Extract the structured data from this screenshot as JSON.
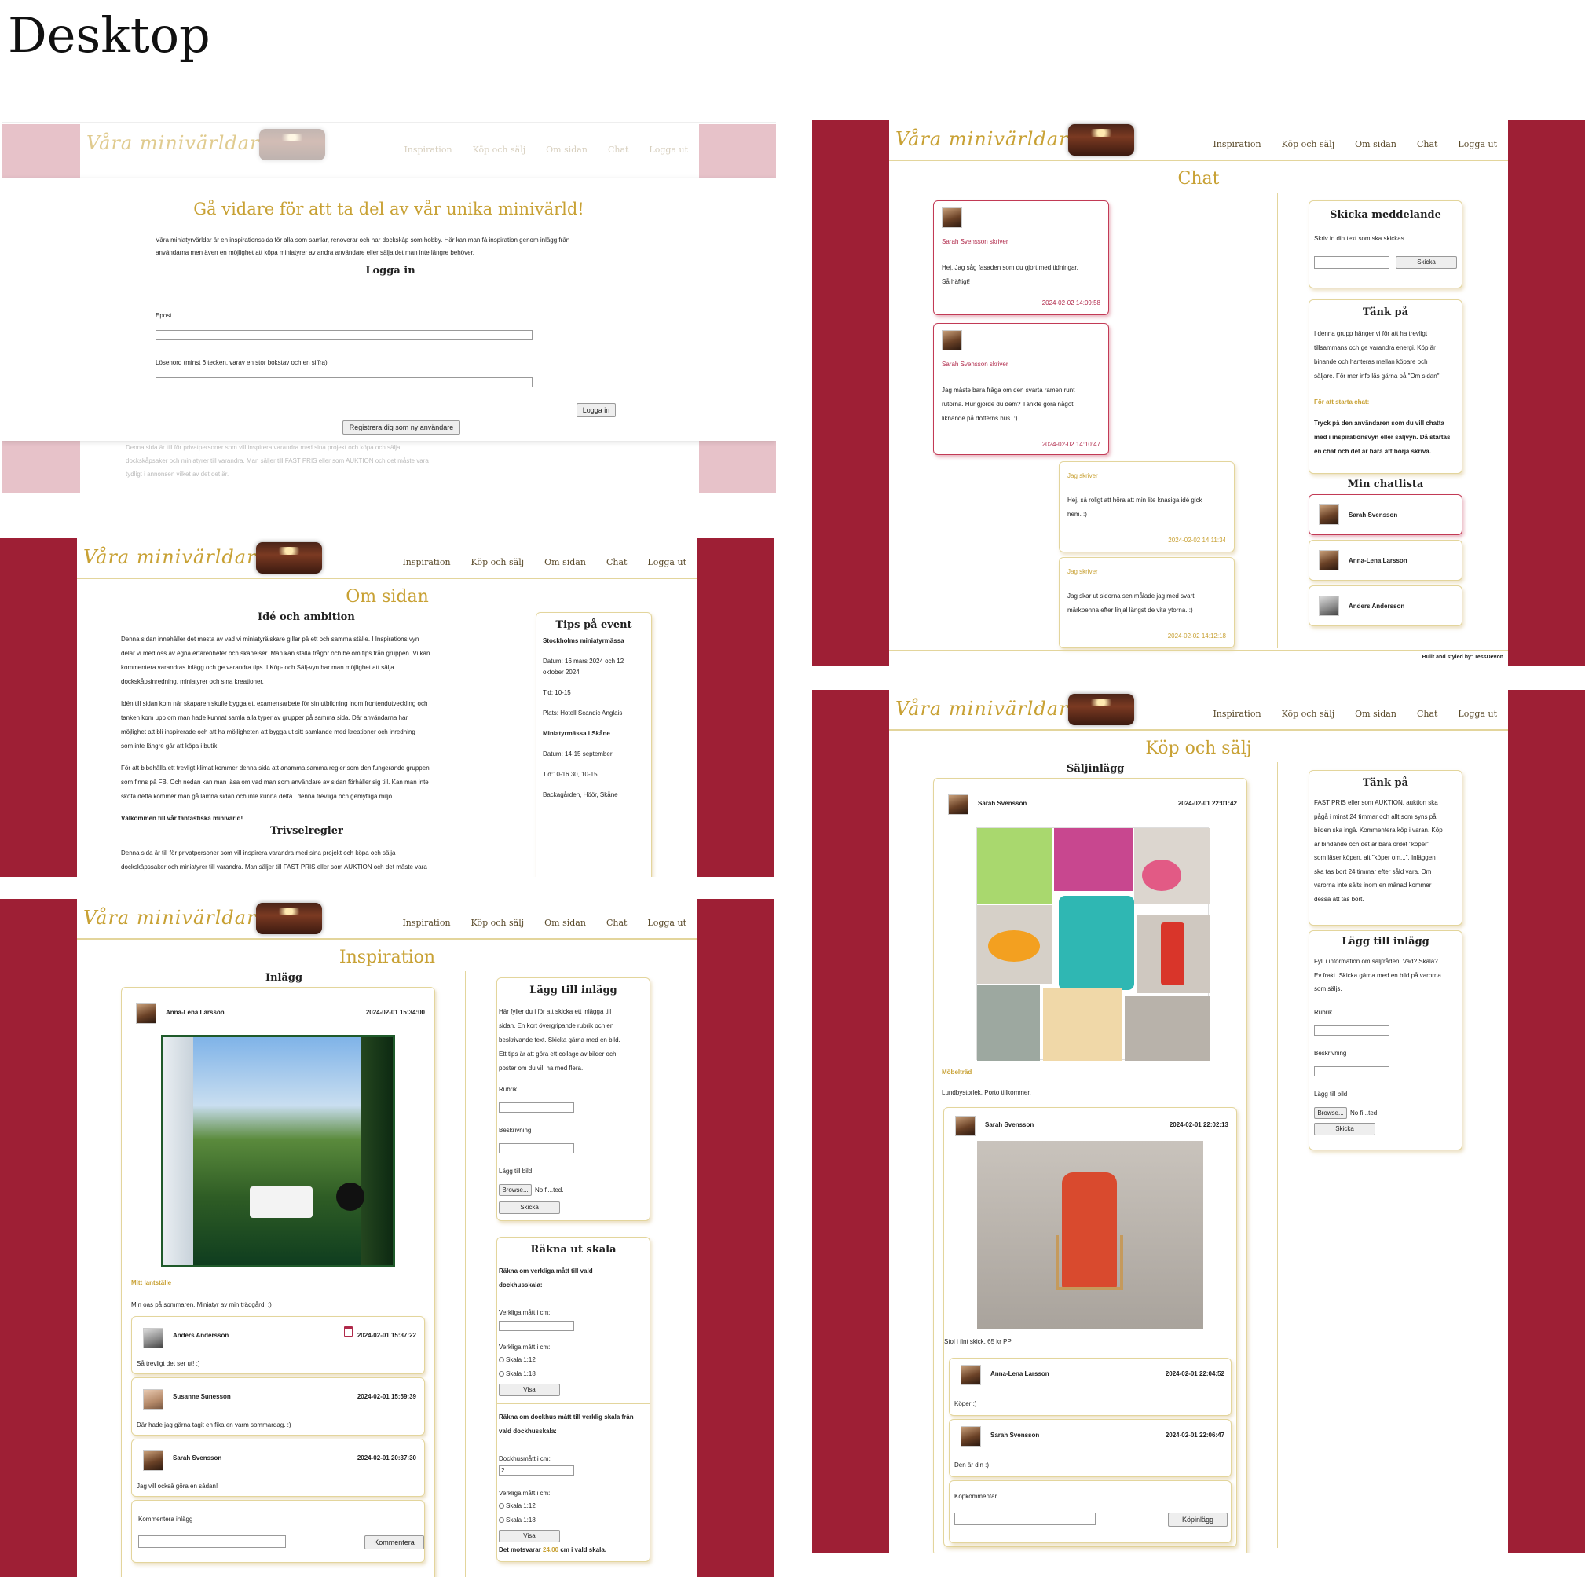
{
  "page_title": "Desktop",
  "site": {
    "logo_text": "Våra minivärldar",
    "nav": [
      "Inspiration",
      "Köp och sälj",
      "Om sidan",
      "Chat",
      "Logga ut"
    ],
    "colors": {
      "side": "#9e1f35",
      "gold": "#c8a134",
      "pink_side": "#e7c2c9"
    }
  },
  "login": {
    "title": "Gå vidare för att ta del av vår unika minivärld!",
    "intro_1": "Våra miniatyrvärldar är en inspirationssida för alla som samlar, renoverar och har dockskåp som hobby. Här kan man få inspiration genom inlägg från",
    "intro_2": "användarna men även en möjlighet att köpa miniatyrer av andra användare eller sälja det man inte längre behöver.",
    "heading": "Logga in",
    "email_label": "Epost",
    "password_label": "Lösenord (minst 6 tecken, varav en stor bokstav och en siffra)",
    "login_button": "Logga in",
    "register_button": "Registrera dig som ny användare",
    "bg_text_1": "Denna sida är till för privatpersoner som vill inspirera varandra med sina projekt och köpa och sälja",
    "bg_text_2": "dockskåpsaker och miniatyrer till varandra. Man säljer till FAST PRIS eller som AUKTION och det måste vara",
    "bg_text_3": "tydligt i annonsen vilket av det det är."
  },
  "about": {
    "title": "Om sidan",
    "idea_heading": "Idé och ambition",
    "p1": [
      "Denna sidan innehåller det mesta av vad vi miniatyrälskare gillar på ett och samma ställe. I Inspirations vyn",
      "delar vi med oss av egna erfarenheter och skapelser. Man kan ställa frågor och be om tips från gruppen. Vi kan",
      "kommentera varandras inlägg och ge varandra tips. I Köp- och Sälj-vyn har man möjlighet att sälja",
      "dockskåpsinredning, miniatyrer och sina kreationer."
    ],
    "p2": [
      "Idén till sidan kom när skaparen skulle bygga ett examensarbete för sin utbildning inom frontendutveckling och",
      "tanken kom upp om man hade kunnat samla alla typer av grupper på samma sida. Där användarna har",
      "möjlighet att bli inspirerade och att ha möjligheten att bygga ut sitt samlande med kreationer och inredning",
      "som inte längre går att köpa i butik."
    ],
    "p3": [
      "För att bibehålla ett trevligt klimat kommer denna sida att anamma samma regler som den fungerande gruppen",
      "som finns på FB. Och nedan kan man läsa om vad man som användare av sidan förhåller sig till. Kan man inte",
      "sköta detta kommer man gå lämna sidan och inte kunna delta i denna trevliga och gemytliga miljö."
    ],
    "welcome": "Välkommen till vår fantastiska minivärld!",
    "rules_heading": "Trivselregler",
    "rules_1": "Denna sida är till för privatpersoner som vill inspirera varandra med sina projekt och köpa och sälja",
    "rules_2": "dockskåpssaker och miniatyrer till varandra. Man säljer till FAST PRIS eller som AUKTION och det måste vara",
    "tips_heading": "Tips på event",
    "tips": [
      "Stockholms miniatyrmässa",
      "Datum: 16 mars 2024 och 12",
      "oktober 2024",
      "Tid: 10-15",
      "Plats: Hotell Scandic Anglais",
      "Miniatyrmässa i Skåne",
      "Datum: 14-15 september",
      "Tid:10-16.30, 10-15",
      "Backagården, Höör, Skåne"
    ]
  },
  "inspiration": {
    "title": "Inspiration",
    "posts_heading": "Inlägg",
    "post": {
      "author": "Anna-Lena Larsson",
      "time": "2024-02-01 15:34:00",
      "heading": "Mitt lantställe",
      "text": "Min oas på sommaren. Miniatyr av min trädgård. :)"
    },
    "comments": [
      {
        "author": "Anders Andersson",
        "time": "2024-02-01 15:37:22",
        "text": "Så trevligt det ser ut! :)"
      },
      {
        "author": "Susanne Sunesson",
        "time": "2024-02-01 15:59:39",
        "text": "Där hade jag gärna tagit en fika en varm sommardag. :)"
      },
      {
        "author": "Sarah Svensson",
        "time": "2024-02-01 20:37:30",
        "text": "Jag vill också göra en sådan!"
      }
    ],
    "comment_label": "Kommentera inlägg",
    "comment_button": "Kommentera",
    "add_heading": "Lägg till inlägg",
    "add_text": [
      "Här fyller du i för att skicka ett inlägga till",
      "sidan. En kort övergripande rubrik och en",
      "beskrivande text. Skicka gärna med en bild.",
      "Ett tips är att göra ett collage av bilder och",
      "poster om du vill ha med flera."
    ],
    "rubrik": "Rubrik",
    "beskrivning": "Beskrivning",
    "add_image": "Lägg till bild",
    "browse": "Browse...",
    "no_file": "No fi...ted.",
    "send": "Skicka",
    "scale_heading": "Räkna ut skala",
    "scale_q1": [
      "Räkna om verkliga mått till vald",
      "dockhusskala:"
    ],
    "real_cm": "Verkliga mått i cm:",
    "scale_112": "Skala 1:12",
    "scale_118": "Skala 1:18",
    "show": "Visa",
    "scale_q2": [
      "Räkna om dockhus mått till verklig skala från",
      "vald dockhusskala:"
    ],
    "doll_cm": "Dockhusmått i cm:",
    "doll_value": "2",
    "result_prefix": "Det motsvarar",
    "result_value": "24.00",
    "result_suffix": "cm i vald skala."
  },
  "chat": {
    "title": "Chat",
    "messages": [
      {
        "who": "Sarah Svensson skriver",
        "lines": [
          "Hej, Jag såg fasaden som du gjort med tidningar.",
          "Så häftigt!"
        ],
        "time": "2024-02-02 14:09:58"
      },
      {
        "who": "Sarah Svensson skriver",
        "lines": [
          "Jag måste bara fråga om den svarta ramen runt",
          "rutorna. Hur gjorde du dem? Tänkte göra något",
          "liknande på dotterns hus. :)"
        ],
        "time": "2024-02-02 14:10:47"
      },
      {
        "who": "Jag skriver",
        "lines": [
          "Hej, så roligt att höra att min lite knasiga idé gick",
          "hem. :)"
        ],
        "time": "2024-02-02 14:11:34"
      },
      {
        "who": "Jag skriver",
        "lines": [
          "Jag skar ut sidorna sen målade jag med svart",
          "märkpenna efter linjal längst de vita ytorna. :)"
        ],
        "time": "2024-02-02 14:12:18"
      }
    ],
    "send_heading": "Skicka meddelande",
    "send_label": "Skriv in din text som ska skickas",
    "send_button": "Skicka",
    "think_heading": "Tänk på",
    "think_text": [
      "I denna grupp hänger vi för att ha trevligt",
      "tillsammans och ge varandra energi. Köp är",
      "binande och hanteras mellan köpare och",
      "säljare. För mer info läs gärna på \"Om sidan\""
    ],
    "start_label": "För att starta chat:",
    "start_text": [
      "Tryck på den användaren som du vill chatta",
      "med i inspirationsvyn eller säljvyn. Då startas",
      "en chat och det är bara att börja skriva."
    ],
    "list_heading": "Min chatlista",
    "list": [
      "Sarah Svensson",
      "Anna-Lena Larsson",
      "Anders Andersson"
    ],
    "footer": "Built and styled by: TessDevon"
  },
  "shop": {
    "title": "Köp och sälj",
    "ads_heading": "Säljinlägg",
    "post": {
      "author": "Sarah Svensson",
      "time": "2024-02-01 22:01:42",
      "heading": "Möbelträd",
      "text": "Lundbystorlek. Porto tillkommer."
    },
    "sub": {
      "author": "Sarah Svensson",
      "time": "2024-02-01 22:02:13",
      "text": "Stol i fint skick, 65 kr PP"
    },
    "comments": [
      {
        "author": "Anna-Lena Larsson",
        "time": "2024-02-01 22:04:52",
        "text": "Köper :)"
      },
      {
        "author": "Sarah Svensson",
        "time": "2024-02-01 22:06:47",
        "text": "Den är din :)"
      }
    ],
    "buy_label": "Köpkommentar",
    "buy_button": "Köpinlägg",
    "think_heading": "Tänk på",
    "think_text": [
      "FAST PRIS eller som AUKTION, auktion ska",
      "pågå i minst 24 timmar och allt som syns på",
      "bilden ska ingå. Kommentera köp i varan. Köp",
      "är bindande och det är bara ordet \"köper\"",
      "som läser köpen, alt \"köper om...\". Inläggen",
      "ska tas bort 24 timmar efter såld vara. Om",
      "varorna inte sålts inom en månad kommer",
      "dessa att tas bort."
    ],
    "add_heading": "Lägg till inlägg",
    "add_text": [
      "Fyll i information om säljtråden. Vad? Skala?",
      "Ev frakt. Skicka gärna med en bild på varorna",
      "som säljs."
    ],
    "rubrik": "Rubrik",
    "beskrivning": "Beskrivning",
    "add_image": "Lägg till bild",
    "browse": "Browse...",
    "no_file": "No fi...ted.",
    "send": "Skicka"
  }
}
